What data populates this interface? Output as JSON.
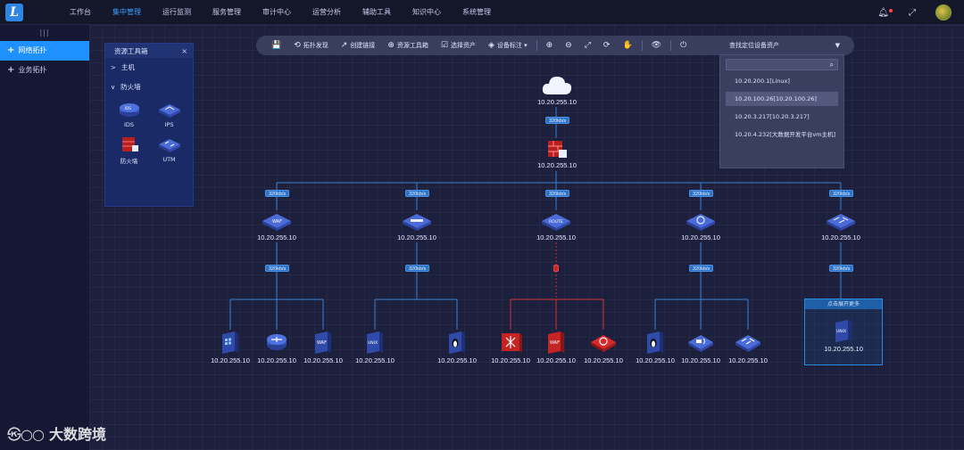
{
  "app": {
    "logo_char": "L"
  },
  "nav": {
    "items": [
      {
        "label": "工作台"
      },
      {
        "label": "集中管理",
        "active": true
      },
      {
        "label": "运行监测"
      },
      {
        "label": "服务管理"
      },
      {
        "label": "审计中心"
      },
      {
        "label": "运营分析"
      },
      {
        "label": "辅助工具"
      },
      {
        "label": "知识中心"
      },
      {
        "label": "系统管理"
      }
    ]
  },
  "top_icons": {
    "bell": "bell-icon",
    "fullscreen": "fullscreen-icon",
    "avatar": "avatar"
  },
  "sidebar": {
    "handle": "|||",
    "items": [
      {
        "label": "网络拓扑",
        "active": true
      },
      {
        "label": "业务拓扑"
      }
    ]
  },
  "toolbar": {
    "save_icon": "💾",
    "buttons": [
      {
        "icon": "⟲",
        "label": "拓扑发现"
      },
      {
        "icon": "↗",
        "label": "创建链接"
      },
      {
        "icon": "⊕",
        "label": "资源工具箱"
      },
      {
        "icon": "☑",
        "label": "选择资产"
      },
      {
        "icon": "◈",
        "label": "设备标注 ▾"
      }
    ],
    "zoom_in": "⊕",
    "zoom_out": "⊖",
    "fit": "⤢",
    "refresh": "⟳",
    "hand": "✋",
    "eye": "👁",
    "reset": "⏻",
    "select_value": "查找定位设备资产",
    "caret": "▼"
  },
  "dropdown": {
    "search_placeholder": "",
    "search_icon": "⌕",
    "items": [
      {
        "label": "10.20.200.1[Linux]"
      },
      {
        "label": "10.20.100.26[10.20.100.26]",
        "selected": true
      },
      {
        "label": "10.20.3.217[10.20.3.217]"
      },
      {
        "label": "10.20.4.232[大数据开发平台vm主机]"
      }
    ]
  },
  "toolbox": {
    "title": "资源工具箱",
    "close": "×",
    "groups": [
      {
        "label": "主机",
        "chev": ">"
      },
      {
        "label": "防火墙",
        "chev": "∨"
      }
    ],
    "items": [
      {
        "label": "IDS"
      },
      {
        "label": "IPS"
      },
      {
        "label": "防火墙"
      },
      {
        "label": "UTM"
      }
    ]
  },
  "topology": {
    "cloud": {
      "label": "10.20.255.10"
    },
    "firewall": {
      "label": "10.20.255.10"
    },
    "switches": [
      {
        "label": "10.20.255.10"
      },
      {
        "label": "10.20.255.10"
      },
      {
        "label": "10.20.255.10"
      },
      {
        "label": "10.20.255.10"
      },
      {
        "label": "10.20.255.10"
      }
    ],
    "leaves": [
      {
        "label": "10.20.255.10"
      },
      {
        "label": "10.20.255.10"
      },
      {
        "label": "10.20.255.10"
      },
      {
        "label": "10.20.255.10"
      },
      {
        "label": "10.20.255.10"
      },
      {
        "label": "10.20.255.10"
      },
      {
        "label": "10.20.255.10"
      },
      {
        "label": "10.20.255.10"
      },
      {
        "label": "10.20.255.10"
      },
      {
        "label": "10.20.255.10"
      },
      {
        "label": "10.20.255.10"
      }
    ],
    "group_node": {
      "label": "10.20.255.10",
      "header": "点击展开更多"
    },
    "link_badge": "320kb/s"
  },
  "watermark": {
    "logo": "㉿○○",
    "text": "大数跨境"
  }
}
